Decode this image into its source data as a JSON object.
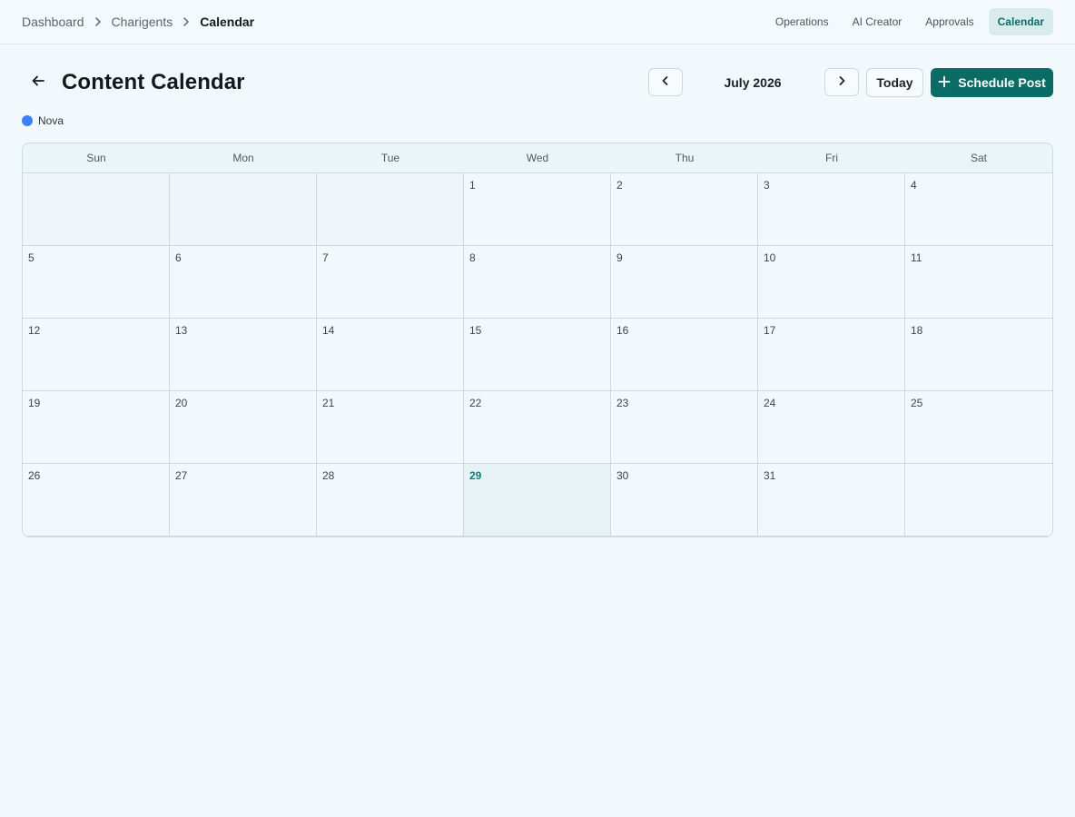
{
  "breadcrumb": {
    "items": [
      "Dashboard",
      "Charigents"
    ],
    "current": "Calendar"
  },
  "topnav": {
    "items": [
      {
        "label": "Operations",
        "active": false
      },
      {
        "label": "AI Creator",
        "active": false
      },
      {
        "label": "Approvals",
        "active": false
      },
      {
        "label": "Calendar",
        "active": true
      }
    ]
  },
  "header": {
    "title": "Content Calendar",
    "month_label": "July 2026",
    "today_label": "Today",
    "schedule_label": "Schedule Post"
  },
  "legend": {
    "items": [
      {
        "label": "Nova",
        "color": "#3b82f6"
      }
    ]
  },
  "calendar": {
    "weekdays": [
      "Sun",
      "Mon",
      "Tue",
      "Wed",
      "Thu",
      "Fri",
      "Sat"
    ],
    "leading_blanks": 3,
    "days_in_month": 31,
    "today": 29
  },
  "colors": {
    "accent": "#0d6b66",
    "today_text": "#0f7f7a",
    "legend_nova": "#3b82f6"
  },
  "icons": {
    "back": "arrow-left-icon",
    "prev": "chevron-left-icon",
    "next": "chevron-right-icon",
    "add": "plus-icon",
    "breadcrumb_sep": "chevron-right-icon"
  }
}
